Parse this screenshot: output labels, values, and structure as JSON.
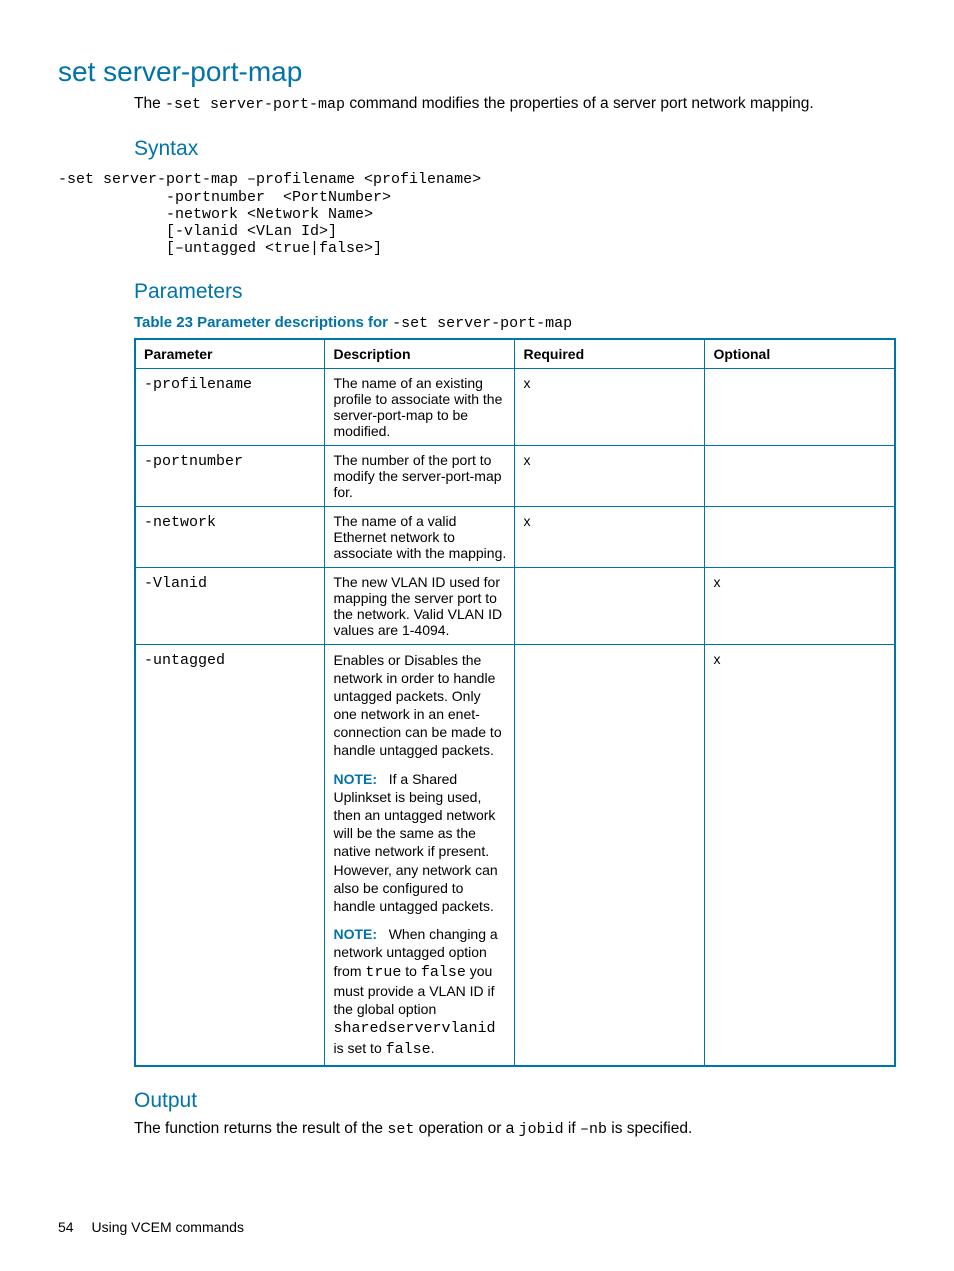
{
  "title": "set server-port-map",
  "intro_pre": "The ",
  "intro_code": "-set server-port-map",
  "intro_post": " command modifies the properties of a server port network mapping.",
  "syntax": {
    "heading": "Syntax",
    "code": "-set server-port-map –profilename <profilename>\n            -portnumber  <PortNumber>\n            -network <Network Name>\n            [-vlanid <VLan Id>]\n            [–untagged <true|false>]"
  },
  "parameters": {
    "heading": "Parameters",
    "caption_label": "Table 23 Parameter descriptions for",
    "caption_code": "-set server-port-map",
    "headers": {
      "p": "Parameter",
      "d": "Description",
      "r": "Required",
      "o": "Optional"
    },
    "rows": [
      {
        "param": "-profilename",
        "desc": "The name of an existing profile to associate with the server-port-map to be modified.",
        "required": "x",
        "optional": ""
      },
      {
        "param": "-portnumber",
        "desc": "The number of the port to modify the server-port-map for.",
        "required": "x",
        "optional": ""
      },
      {
        "param": "-network",
        "desc": "The name of a valid Ethernet network to associate with the mapping.",
        "required": "x",
        "optional": ""
      },
      {
        "param": "-Vlanid",
        "desc": "The new VLAN ID used for mapping the server port to the network. Valid VLAN ID values are 1-4094.",
        "required": "",
        "optional": "x"
      }
    ],
    "untagged": {
      "param": "-untagged",
      "desc1": "Enables or Disables the network in order to handle untagged packets. Only one network in an enet-connection can be made to handle untagged packets.",
      "note_label": "NOTE:",
      "note1": "If a Shared Uplinkset is being used, then an untagged network will be the same as the native network if present. However, any network can also be configured to handle untagged packets.",
      "note2_pre": "When changing a network untagged option from ",
      "note2_code1": "true",
      "note2_mid": " to ",
      "note2_code2": "false",
      "note2_post1": " you must provide a VLAN ID if the global option ",
      "note2_code3": "sharedservervlanid",
      "note2_post2": " is set to ",
      "note2_code4": "false",
      "note2_post3": ".",
      "required": "",
      "optional": "x"
    }
  },
  "output": {
    "heading": "Output",
    "text_pre": "The function returns the result of the ",
    "code1": "set",
    "text_mid1": " operation or a ",
    "code2": "jobid",
    "text_mid2": " if ",
    "code3": "–nb",
    "text_post": " is specified."
  },
  "footer": {
    "page": "54",
    "text": "Using VCEM commands"
  }
}
